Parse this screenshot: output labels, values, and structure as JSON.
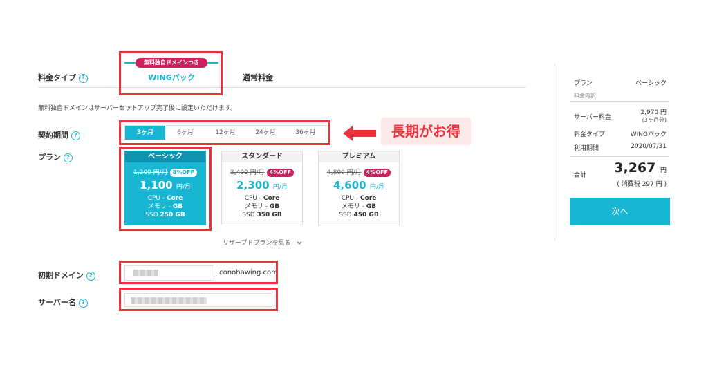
{
  "form": {
    "plan_type_label": "料金タイプ",
    "tabs": {
      "wing_badge": "無料独自ドメインつき",
      "wing_label": "WINGパック",
      "normal_label": "通常料金"
    },
    "domain_note": "無料独自ドメインはサーバーセットアップ完了後に設定いただけます。",
    "period_label": "契約期間",
    "periods": [
      "3ヶ月",
      "6ヶ月",
      "12ヶ月",
      "24ヶ月",
      "36ヶ月"
    ],
    "callout": "長期がお得",
    "plan_label": "プラン",
    "plans": [
      {
        "name": "ベーシック",
        "old_price": "1,200 円/月",
        "discount": "8%OFF",
        "price": "1,100",
        "unit": "円/月",
        "cpu_label": "CPU - ",
        "cpu": "Core",
        "mem_label": "メモリ - ",
        "mem": "GB",
        "ssd_label": "SSD ",
        "ssd": "250 GB"
      },
      {
        "name": "スタンダード",
        "old_price": "2,400 円/月",
        "discount": "4%OFF",
        "price": "2,300",
        "unit": "円/月",
        "cpu_label": "CPU - ",
        "cpu": "Core",
        "mem_label": "メモリ - ",
        "mem": "GB",
        "ssd_label": "SSD ",
        "ssd": "350 GB"
      },
      {
        "name": "プレミアム",
        "old_price": "4,800 円/月",
        "discount": "4%OFF",
        "price": "4,600",
        "unit": "円/月",
        "cpu_label": "CPU - ",
        "cpu": "Core",
        "mem_label": "メモリ - ",
        "mem": "GB",
        "ssd_label": "SSD ",
        "ssd": "450 GB"
      }
    ],
    "reserved_link": "リザーブドプランを見る",
    "initial_domain_label": "初期ドメイン",
    "domain_suffix": ".conohawing.com",
    "server_name_label": "サーバー名"
  },
  "summary": {
    "plan_label": "プラン",
    "plan_value": "ベーシック",
    "breakdown_label": "料金内訳",
    "server_fee_label": "サーバー料金",
    "server_fee_value": "2,970 円",
    "server_fee_note": "(3ヶ月分)",
    "type_label": "料金タイプ",
    "type_value": "WINGパック",
    "period_label": "利用期間",
    "period_value": "2020/07/31",
    "total_label": "合計",
    "total_value": "3,267",
    "total_unit": "円",
    "tax_note": "( 消費税 297 円 )",
    "next_button": "次へ"
  },
  "colors": {
    "accent": "#19b6d3",
    "highlight": "#e8323c",
    "badge": "#c8215d"
  }
}
